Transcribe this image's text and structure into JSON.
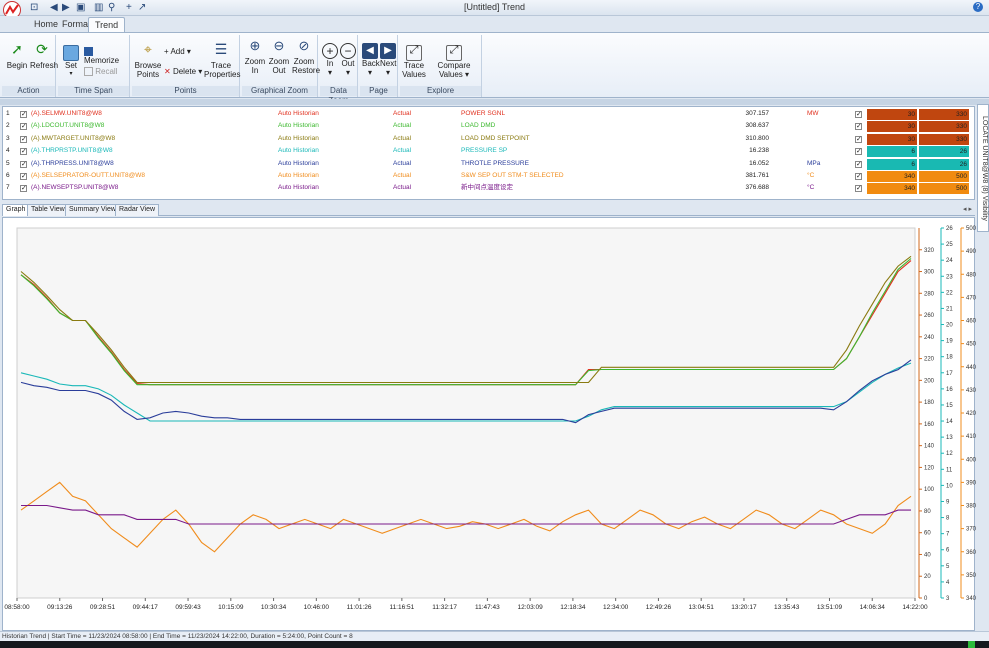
{
  "window": {
    "title": "[Untitled] Trend",
    "help": "?"
  },
  "tabs": [
    "Home",
    "Format",
    "Trend"
  ],
  "ribbon": {
    "groups": [
      {
        "label": "Action",
        "buttons": [
          "Begin",
          "Refresh"
        ]
      },
      {
        "label": "Time Span",
        "buttons": [
          "Set",
          "Memorize",
          "Recall"
        ]
      },
      {
        "label": "Points",
        "buttons": [
          "Browse Points",
          "Add",
          "Delete",
          "Trace Properties"
        ]
      },
      {
        "label": "Graphical Zoom",
        "buttons": [
          "Zoom In",
          "Zoom Out",
          "Zoom Restore"
        ]
      },
      {
        "label": "Data Zoom",
        "buttons": [
          "In",
          "Out"
        ]
      },
      {
        "label": "Page",
        "buttons": [
          "Back",
          "Next"
        ]
      },
      {
        "label": "Explore",
        "buttons": [
          "Trace Values",
          "Compare Values"
        ]
      }
    ]
  },
  "tags": [
    {
      "n": "1",
      "name": "(A).SELMW.UNIT8@W8",
      "source": "Auto Historian",
      "type": "Actual",
      "desc": "POWER SGNL",
      "value": "307.157",
      "unit": "MW",
      "min": "30",
      "max": "330",
      "color": "#e0301e",
      "bg": "#c0460f"
    },
    {
      "n": "2",
      "name": "(A).LDCOUT.UNIT8@W8",
      "source": "Auto Historian",
      "type": "Actual",
      "desc": "LOAD DMD",
      "value": "308.637",
      "unit": "",
      "min": "30",
      "max": "330",
      "color": "#3cb82e",
      "bg": "#c0460f"
    },
    {
      "n": "3",
      "name": "(A).MWTARGET.UNIT8@W8",
      "source": "Auto Historian",
      "type": "Actual",
      "desc": "LOAD DMD SETPOINT",
      "value": "310.800",
      "unit": "",
      "min": "30",
      "max": "330",
      "color": "#8a7a10",
      "bg": "#c0460f"
    },
    {
      "n": "4",
      "name": "(A).THRPRSTP.UNIT8@W8",
      "source": "Auto Historian",
      "type": "Actual",
      "desc": "PRESSURE SP",
      "value": "16.238",
      "unit": "",
      "min": "6",
      "max": "26",
      "color": "#1ab8b8",
      "bg": "#19b9b2"
    },
    {
      "n": "5",
      "name": "(A).THRPRESS.UNIT8@W8",
      "source": "Auto Historian",
      "type": "Actual",
      "desc": "THROTLE PRESSURE",
      "value": "16.052",
      "unit": "MPa",
      "min": "6",
      "max": "26",
      "color": "#2a3d9a",
      "bg": "#19b9b2"
    },
    {
      "n": "6",
      "name": "(A).SELSEPRATOR-OUTT.UNIT8@W8",
      "source": "Auto Historian",
      "type": "Actual",
      "desc": "S&W SEP OUT STM-T SELECTED",
      "value": "381.761",
      "unit": "°C",
      "min": "340",
      "max": "500",
      "color": "#f08c1c",
      "bg": "#f18b10"
    },
    {
      "n": "7",
      "name": "(A).NEWSEPTSP.UNIT8@W8",
      "source": "Auto Historian",
      "type": "Actual",
      "desc": "新中间点温度设定",
      "value": "376.688",
      "unit": "°C",
      "min": "340",
      "max": "500",
      "color": "#7a1a8a",
      "bg": "#f18b10"
    }
  ],
  "side_label": "LOCATE UNIT8@W8 (8) Visibility",
  "view_tabs": [
    "Graph",
    "Table View",
    "Summary View",
    "Radar View"
  ],
  "chart_data": {
    "type": "line",
    "x_ticks": [
      "08:58:00",
      "09:13:26",
      "09:28:51",
      "09:44:17",
      "09:59:43",
      "10:15:09",
      "10:30:34",
      "10:46:00",
      "11:01:26",
      "11:16:51",
      "11:32:17",
      "11:47:43",
      "12:03:09",
      "12:18:34",
      "12:34:00",
      "12:49:26",
      "13:04:51",
      "13:20:17",
      "13:35:43",
      "13:51:09",
      "14:06:34",
      "14:22:00"
    ],
    "axes": [
      {
        "name": "MW",
        "color": "#d2691e",
        "min": 0,
        "max": 340,
        "ticks": [
          "0",
          "20",
          "40",
          "60",
          "80",
          "100",
          "120",
          "140",
          "160",
          "180",
          "200",
          "220",
          "240",
          "260",
          "280",
          "300",
          "320"
        ]
      },
      {
        "name": "MPa",
        "color": "#1ab8b8",
        "min": 3,
        "max": 26,
        "ticks": [
          "3",
          "4",
          "5",
          "6",
          "7",
          "8",
          "9",
          "10",
          "11",
          "12",
          "13",
          "14",
          "15",
          "16",
          "17",
          "18",
          "19",
          "20",
          "21",
          "22",
          "23",
          "24",
          "25",
          "26"
        ]
      },
      {
        "name": "°C",
        "color": "#f08c1c",
        "min": 340,
        "max": 500,
        "ticks": [
          "340",
          "350",
          "360",
          "370",
          "380",
          "390",
          "400",
          "410",
          "420",
          "430",
          "440",
          "450",
          "460",
          "470",
          "480",
          "490",
          "500"
        ]
      }
    ],
    "series": [
      {
        "name": "SELMW",
        "color": "#e0301e",
        "axis": 0,
        "y": [
          297,
          288,
          276,
          262,
          255,
          255,
          240,
          226,
          210,
          197,
          196,
          196,
          196,
          196,
          196,
          196,
          196,
          196,
          196,
          196,
          196,
          196,
          196,
          196,
          196,
          196,
          196,
          196,
          196,
          196,
          196,
          196,
          196,
          196,
          196,
          196,
          196,
          196,
          196,
          196,
          196,
          196,
          196,
          196,
          210,
          210,
          210,
          210,
          210,
          210,
          210,
          210,
          210,
          210,
          210,
          210,
          210,
          210,
          210,
          210,
          210,
          210,
          210,
          210,
          220,
          240,
          260,
          280,
          300,
          310
        ]
      },
      {
        "name": "LDCOUT",
        "color": "#3cb82e",
        "axis": 0,
        "y": [
          297,
          287,
          275,
          262,
          255,
          255,
          239,
          225,
          209,
          196,
          196,
          196,
          196,
          196,
          196,
          196,
          196,
          196,
          196,
          196,
          196,
          196,
          196,
          196,
          196,
          196,
          196,
          196,
          196,
          196,
          196,
          196,
          196,
          196,
          196,
          196,
          196,
          196,
          196,
          196,
          196,
          196,
          196,
          196,
          209,
          210,
          210,
          210,
          210,
          210,
          210,
          210,
          210,
          210,
          210,
          210,
          210,
          210,
          210,
          210,
          210,
          210,
          210,
          210,
          220,
          240,
          262,
          282,
          302,
          312
        ]
      },
      {
        "name": "MWTARGET",
        "color": "#8a7a10",
        "axis": 0,
        "y": [
          300,
          290,
          278,
          265,
          255,
          255,
          242,
          228,
          212,
          198,
          198,
          198,
          198,
          198,
          198,
          198,
          198,
          198,
          198,
          198,
          198,
          198,
          198,
          198,
          198,
          198,
          198,
          198,
          198,
          198,
          198,
          198,
          198,
          198,
          198,
          198,
          198,
          198,
          198,
          198,
          198,
          198,
          198,
          198,
          198,
          212,
          212,
          212,
          212,
          212,
          212,
          212,
          212,
          212,
          212,
          212,
          212,
          212,
          212,
          212,
          212,
          212,
          212,
          212,
          228,
          250,
          270,
          290,
          305,
          314
        ]
      },
      {
        "name": "THRPRSTP",
        "color": "#1ab8b8",
        "axis": 1,
        "y": [
          17,
          16.8,
          16.6,
          16.3,
          16.2,
          16.2,
          16.0,
          15.6,
          15.0,
          14.5,
          14.0,
          14.0,
          14.0,
          14.0,
          14.0,
          14.0,
          14.0,
          14.0,
          14.0,
          14.0,
          14.0,
          14.0,
          14.0,
          14.0,
          14.0,
          14.0,
          14.0,
          14.0,
          14.0,
          14.0,
          14.0,
          14.0,
          14.0,
          14.0,
          14.0,
          14.0,
          14.0,
          14.0,
          14.0,
          14.0,
          14.0,
          14.0,
          14.0,
          14.0,
          14.3,
          14.7,
          14.9,
          14.9,
          14.9,
          14.9,
          14.9,
          14.9,
          14.9,
          14.9,
          14.9,
          14.9,
          14.9,
          14.9,
          14.9,
          14.9,
          14.9,
          14.9,
          14.9,
          14.9,
          15.2,
          15.8,
          16.4,
          16.9,
          17.3,
          17.6
        ]
      },
      {
        "name": "THRPRESS",
        "color": "#2a3d9a",
        "axis": 1,
        "y": [
          16.4,
          16.2,
          16.1,
          15.9,
          15.9,
          15.9,
          15.7,
          15.3,
          14.6,
          14.1,
          14.2,
          14.5,
          14.6,
          14.5,
          14.3,
          14.2,
          14.2,
          14.1,
          14.1,
          14.1,
          14.1,
          14.1,
          14.1,
          14.1,
          14.1,
          14.1,
          14.1,
          14.1,
          14.1,
          14.1,
          14.1,
          14.1,
          14.1,
          14.1,
          14.1,
          14.1,
          14.1,
          14.1,
          14.1,
          14.1,
          14.1,
          14.1,
          14.1,
          13.9,
          14.4,
          14.6,
          14.8,
          14.8,
          14.8,
          14.8,
          14.8,
          14.8,
          14.8,
          14.8,
          14.8,
          14.8,
          14.8,
          14.8,
          14.8,
          14.8,
          14.8,
          14.8,
          14.8,
          14.7,
          15.2,
          15.9,
          16.5,
          16.9,
          17.2,
          17.8
        ]
      },
      {
        "name": "SELSEPRATOR-OUTT",
        "color": "#f08c1c",
        "axis": 2,
        "y": [
          378,
          382,
          386,
          390,
          384,
          382,
          376,
          370,
          366,
          362,
          368,
          374,
          378,
          372,
          364,
          360,
          366,
          372,
          376,
          374,
          370,
          372,
          374,
          372,
          370,
          374,
          372,
          370,
          368,
          370,
          372,
          374,
          372,
          370,
          371,
          373,
          372,
          370,
          372,
          374,
          371,
          369,
          373,
          376,
          378,
          372,
          370,
          374,
          378,
          376,
          372,
          370,
          373,
          375,
          372,
          370,
          374,
          378,
          376,
          372,
          370,
          374,
          378,
          376,
          372,
          370,
          368,
          372,
          380,
          384
        ]
      },
      {
        "name": "NEWSEPTSP",
        "color": "#7a1a8a",
        "axis": 2,
        "y": [
          380,
          380,
          380,
          379,
          378,
          378,
          376,
          376,
          376,
          374,
          374,
          374,
          374,
          372,
          372,
          372,
          372,
          372,
          372,
          372,
          372,
          372,
          372,
          372,
          372,
          372,
          372,
          372,
          372,
          372,
          372,
          372,
          372,
          372,
          372,
          372,
          372,
          372,
          372,
          372,
          372,
          372,
          372,
          372,
          372,
          372,
          372,
          372,
          372,
          372,
          372,
          372,
          372,
          372,
          372,
          372,
          372,
          372,
          372,
          372,
          372,
          372,
          372,
          372,
          374,
          376,
          376,
          376,
          378,
          378
        ]
      }
    ]
  },
  "status": {
    "text": "Historian Trend | Start Time = 11/23/2024 08:58:00 | End Time = 11/23/2024 14:22:00, Duration = 5:24:00, Point Count = 8"
  }
}
